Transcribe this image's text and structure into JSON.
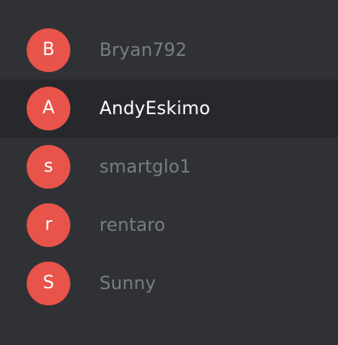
{
  "colors": {
    "background": "#2f3135",
    "active_background": "#26282c",
    "avatar": "#e8534a",
    "name_inactive": "#7a7d82",
    "name_active": "#ffffff"
  },
  "users": [
    {
      "initial": "B",
      "name": "Bryan792",
      "active": false
    },
    {
      "initial": "A",
      "name": "AndyEskimo",
      "active": true
    },
    {
      "initial": "s",
      "name": "smartglo1",
      "active": false
    },
    {
      "initial": "r",
      "name": "rentaro",
      "active": false
    },
    {
      "initial": "S",
      "name": "Sunny",
      "active": false
    }
  ]
}
